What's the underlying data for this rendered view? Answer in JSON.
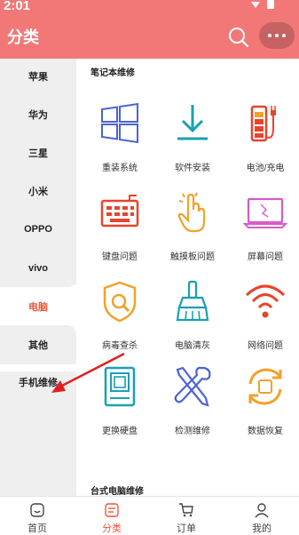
{
  "status": {
    "time": "2:01"
  },
  "header": {
    "title": "分类"
  },
  "sidebar": {
    "items": [
      {
        "label": "苹果"
      },
      {
        "label": "华为"
      },
      {
        "label": "三星"
      },
      {
        "label": "小米"
      },
      {
        "label": "OPPO"
      },
      {
        "label": "vivo"
      },
      {
        "label": "电脑",
        "active": true
      },
      {
        "label": "其他"
      },
      {
        "label": "手机维修"
      }
    ]
  },
  "main": {
    "sections": [
      {
        "title": "笔记本维修",
        "items": [
          {
            "label": "重装系统",
            "icon": "windows-icon"
          },
          {
            "label": "软件安装",
            "icon": "download-icon"
          },
          {
            "label": "电池/充电",
            "icon": "battery-charge-icon"
          },
          {
            "label": "键盘问题",
            "icon": "keyboard-icon"
          },
          {
            "label": "触摸板问题",
            "icon": "touch-hand-icon"
          },
          {
            "label": "屏幕问题",
            "icon": "cracked-screen-icon"
          },
          {
            "label": "病毒查杀",
            "icon": "shield-search-icon"
          },
          {
            "label": "电脑清灰",
            "icon": "broom-icon"
          },
          {
            "label": "网络问题",
            "icon": "wifi-icon"
          },
          {
            "label": "更换硬盘",
            "icon": "hard-drive-icon"
          },
          {
            "label": "检测维修",
            "icon": "tools-icon"
          },
          {
            "label": "数据恢复",
            "icon": "data-recovery-icon"
          }
        ]
      },
      {
        "title": "台式电脑维修",
        "items": []
      }
    ]
  },
  "tabbar": {
    "items": [
      {
        "label": "首页",
        "icon": "home-icon"
      },
      {
        "label": "分类",
        "icon": "category-icon",
        "active": true
      },
      {
        "label": "订单",
        "icon": "cart-icon"
      },
      {
        "label": "我的",
        "icon": "user-icon"
      }
    ]
  },
  "colors": {
    "header": "#f27878",
    "accent": "#f0553c",
    "sidebar_bg": "#efefef",
    "icon_blue": "#4a63d6",
    "icon_red": "#e8442c",
    "icon_orange": "#f2a12c",
    "icon_teal": "#1a9fb3"
  }
}
